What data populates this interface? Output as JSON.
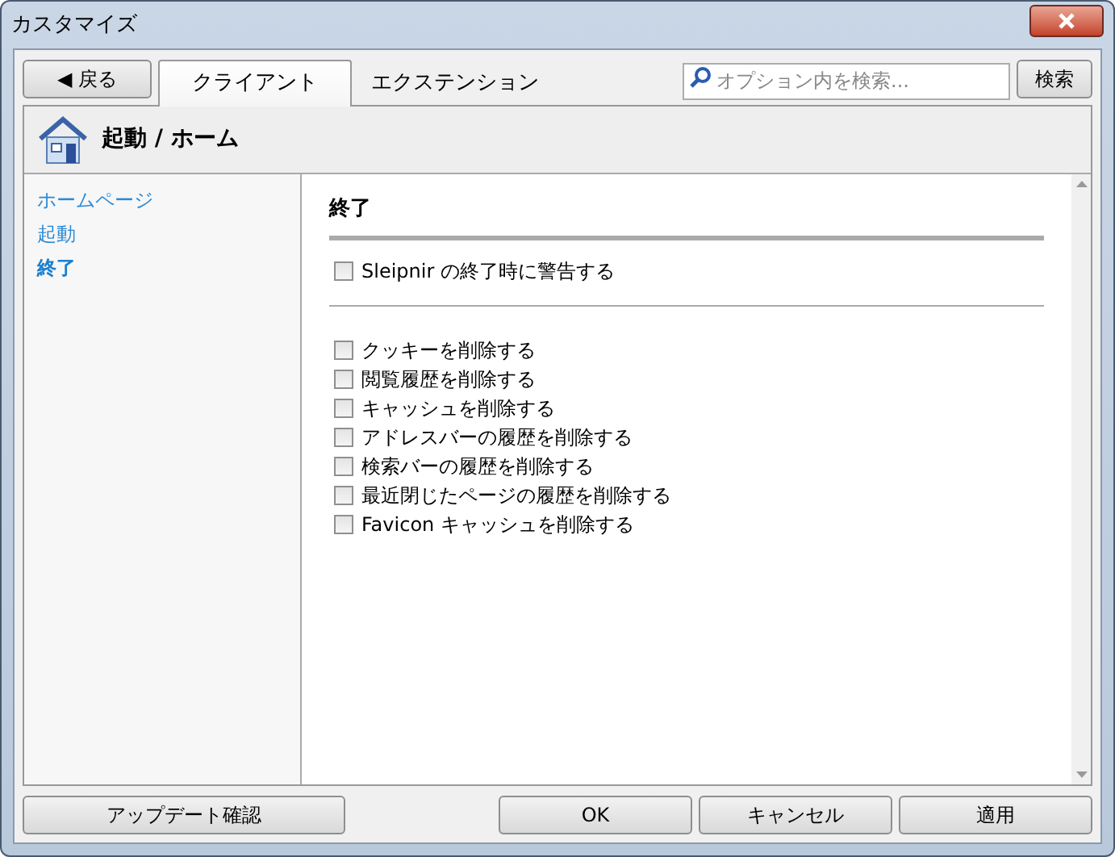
{
  "window": {
    "title": "カスタマイズ"
  },
  "toolbar": {
    "back_button": "◀ 戻る",
    "tabs": [
      {
        "label": "クライアント",
        "selected": true
      },
      {
        "label": "エクステンション",
        "selected": false
      }
    ],
    "search": {
      "placeholder": "オプション内を検索..."
    },
    "search_button": "検索"
  },
  "header": {
    "title": "起動 / ホーム"
  },
  "sidebar": {
    "items": [
      {
        "label": "ホームページ",
        "selected": false
      },
      {
        "label": "起動",
        "selected": false
      },
      {
        "label": "終了",
        "selected": true
      }
    ]
  },
  "section": {
    "title": "終了",
    "groups": [
      [
        {
          "label": "Sleipnir の終了時に警告する",
          "checked": false
        }
      ],
      [
        {
          "label": "クッキーを削除する",
          "checked": false
        },
        {
          "label": "閲覧履歴を削除する",
          "checked": false
        },
        {
          "label": "キャッシュを削除する",
          "checked": false
        },
        {
          "label": "アドレスバーの履歴を削除する",
          "checked": false
        },
        {
          "label": "検索バーの履歴を削除する",
          "checked": false
        },
        {
          "label": "最近閉じたページの履歴を削除する",
          "checked": false
        },
        {
          "label": "Favicon キャッシュを削除する",
          "checked": false
        }
      ]
    ]
  },
  "footer": {
    "update_button": "アップデート確認",
    "buttons": [
      "OK",
      "キャンセル",
      "適用"
    ]
  }
}
